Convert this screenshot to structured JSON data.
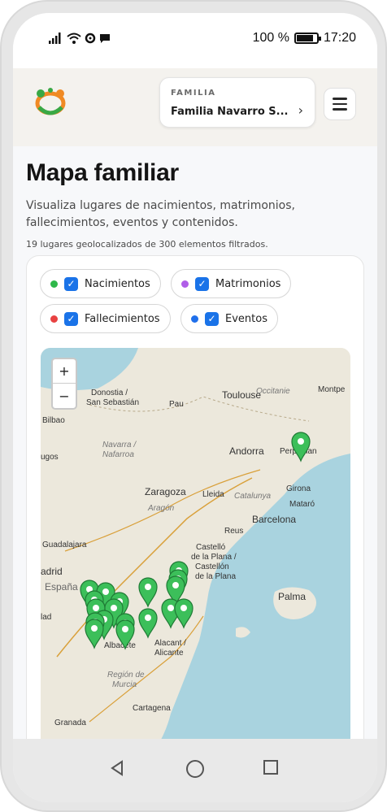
{
  "status_bar": {
    "percent": "100 %",
    "time": "17:20",
    "battery_level": 0.85
  },
  "header": {
    "family_label": "FAMILIA",
    "family_name": "Familia Navarro S...",
    "logo_colors": [
      "#f08a24",
      "#39a845"
    ]
  },
  "page": {
    "title": "Mapa familiar",
    "subtitle": "Visualiza lugares de nacimientos, matrimonios, fallecimientos, eventos y contenidos.",
    "count_text": "19 lugares geolocalizados de 300 elementos filtrados."
  },
  "filters": [
    {
      "label": "Nacimientos",
      "color": "#2eb84a",
      "checked": true
    },
    {
      "label": "Matrimonios",
      "color": "#b05ee8",
      "checked": true
    },
    {
      "label": "Fallecimientos",
      "color": "#e84141",
      "checked": true
    },
    {
      "label": "Eventos",
      "color": "#1f6feb",
      "checked": true
    }
  ],
  "map": {
    "zoom_in": "+",
    "zoom_out": "−",
    "sea_color": "#a9d3df",
    "land_color": "#ece8dc",
    "pin_color": "#3cbf5a",
    "labels": [
      "Donostia /",
      "San Sebastián",
      "Bilbao",
      "Pau",
      "Toulouse",
      "Occitanie",
      "Montpe",
      "Navarra /",
      "Nafarroa",
      "Andorra",
      "Perpignan",
      "Girona",
      "Zaragoza",
      "Lleida",
      "Catalunya",
      "Aragón",
      "Mataró",
      "Barcelona",
      "Reus",
      "Guadalajara",
      "Castelló",
      "de la Plana /",
      "Castellón",
      "de la Plana",
      "adrid",
      "España",
      "Palma",
      "lad",
      "Albacete",
      "Alacant /",
      "Alicante",
      "Región de",
      "Murcia",
      "Cartagena",
      "Granada",
      "ugos"
    ]
  }
}
